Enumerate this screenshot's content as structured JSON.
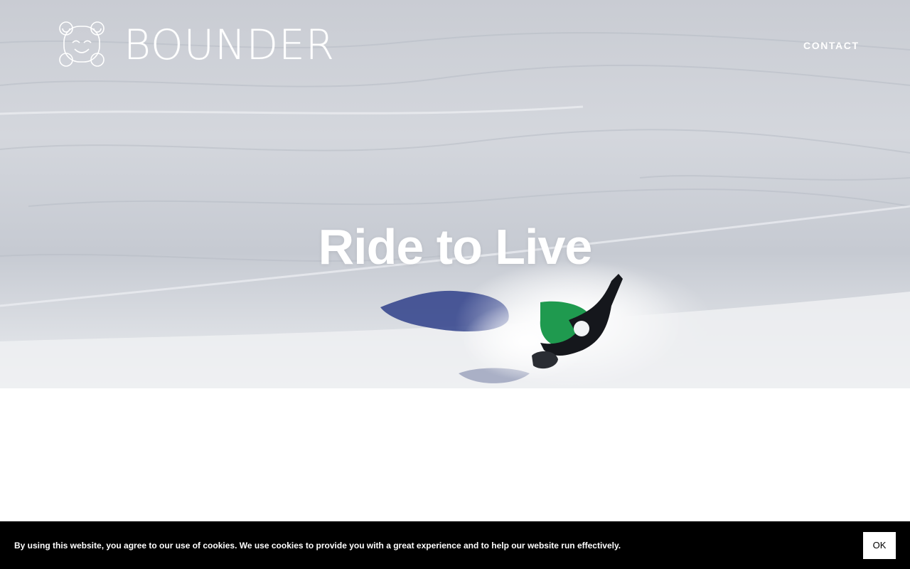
{
  "brand": {
    "name": "BOUNDER",
    "logo_icon": "smiling-bear-icon"
  },
  "nav": {
    "contact_label": "CONTACT"
  },
  "hero": {
    "headline": "Ride to Live"
  },
  "cookie_banner": {
    "message": "By using this website, you agree to our use of cookies. We use cookies to provide you with a great experience and to help our website run effectively.",
    "ok_label": "OK"
  },
  "colors": {
    "cookie_bar_bg": "#000000",
    "text_on_hero": "#ffffff",
    "page_bg": "#ffffff"
  }
}
